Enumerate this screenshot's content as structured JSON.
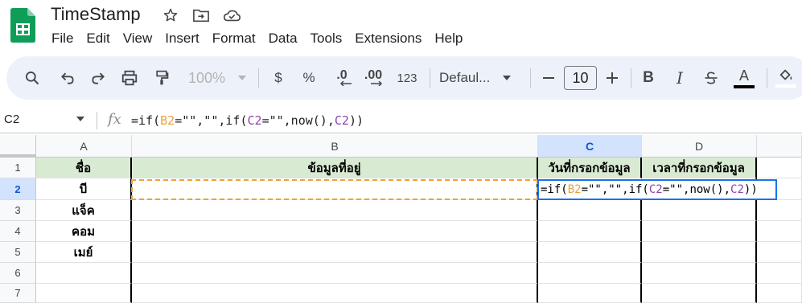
{
  "app": {
    "title": "TimeStamp",
    "menu": [
      "File",
      "Edit",
      "View",
      "Insert",
      "Format",
      "Data",
      "Tools",
      "Extensions",
      "Help"
    ],
    "brand_color": "#0f9d58"
  },
  "toolbar": {
    "zoom": "100%",
    "currency": "$",
    "percent": "%",
    "decrease_decimal": ".0",
    "increase_decimal": ".00",
    "number_format": "123",
    "font_family": "Defaul...",
    "font_size": "10",
    "bold": "B",
    "italic": "I",
    "text_color": "A"
  },
  "formula_bar": {
    "name_box": "C2",
    "fx": "fx",
    "formula_parts": [
      "=if(",
      "B2",
      "=\"\",\"\",if(",
      "C2",
      "=\"\",now(),",
      "C2",
      "))"
    ]
  },
  "sheet": {
    "columns": [
      "A",
      "B",
      "C",
      "D"
    ],
    "rows": [
      "1",
      "2",
      "3",
      "4",
      "5",
      "6",
      "7"
    ],
    "header_row": [
      "ชื่อ",
      "ข้อมูลที่อยู่",
      "วันที่กรอกข้อมูล",
      "เวลาที่กรอกข้อมูล"
    ],
    "names": [
      "บี",
      "แจ็ค",
      "คอม",
      "เมย์"
    ],
    "active_cell": "C2",
    "header_fill": "#d9ead3"
  }
}
